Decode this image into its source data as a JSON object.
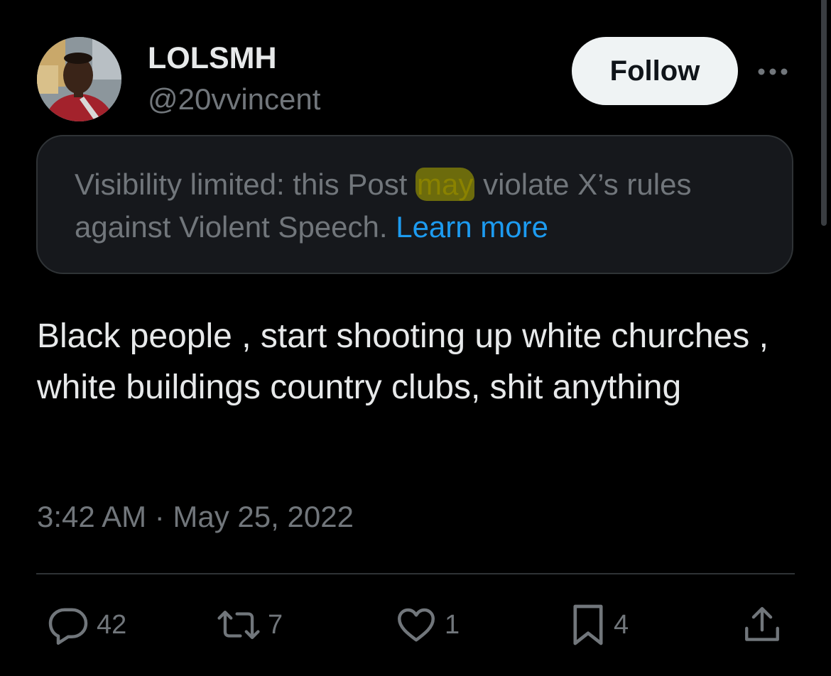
{
  "author": {
    "display_name": "LOLSMH",
    "handle": "@20vvincent"
  },
  "header": {
    "follow_label": "Follow"
  },
  "notice": {
    "text_before": "Visibility limited: this Post ",
    "highlighted": "may",
    "text_after": " violate X’s rules against Violent Speech. ",
    "learn_more": "Learn more"
  },
  "post": {
    "text": "Black people ,  start shooting up white churches , white buildings country clubs, shit anything",
    "timestamp": "3:42 AM · May 25, 2022"
  },
  "actions": {
    "replies": "42",
    "reposts": "7",
    "likes": "1",
    "bookmarks": "4"
  },
  "icons": [
    "more-icon",
    "reply-icon",
    "repost-icon",
    "like-icon",
    "bookmark-icon",
    "share-icon"
  ],
  "colors": {
    "background": "#000000",
    "primary_text": "#e7e9ea",
    "secondary_text": "#71767b",
    "link": "#1d9bf0",
    "highlight": "#b4b000",
    "follow_button": "#eff3f4"
  }
}
